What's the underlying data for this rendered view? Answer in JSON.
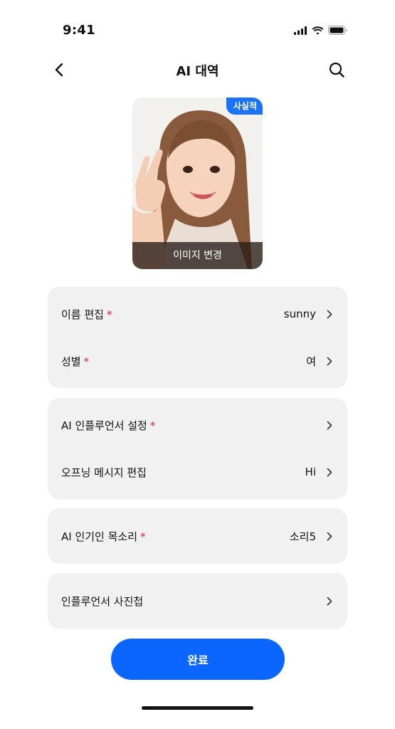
{
  "status_bar": {
    "time": "9:41"
  },
  "header": {
    "title": "AI 대역"
  },
  "profile": {
    "style_badge": "사실적",
    "change_image_label": "이미지 변경"
  },
  "form": {
    "groups": [
      {
        "rows": [
          {
            "label": "이름 편집",
            "required_mark": "*",
            "value": "sunny"
          },
          {
            "label": "성별",
            "required_mark": "*",
            "value": "여"
          }
        ]
      },
      {
        "rows": [
          {
            "label": "AI 인플루언서 설정",
            "required_mark": "*",
            "value": ""
          },
          {
            "label": "오프닝 메시지 편집",
            "value": "Hi"
          }
        ]
      },
      {
        "rows": [
          {
            "label": "AI 인기인 목소리",
            "required_mark": "*",
            "value": "소리5"
          }
        ]
      },
      {
        "rows": [
          {
            "label": "인플루언서 사진첩",
            "value": ""
          }
        ]
      }
    ]
  },
  "actions": {
    "done_label": "완료"
  },
  "colors": {
    "accent": "#0a66ff",
    "required": "#e8233a",
    "group_bg": "#f1f1f1"
  },
  "icons": {
    "back": "chevron-left-icon",
    "search": "search-icon",
    "row_arrow": "chevron-right-icon"
  }
}
